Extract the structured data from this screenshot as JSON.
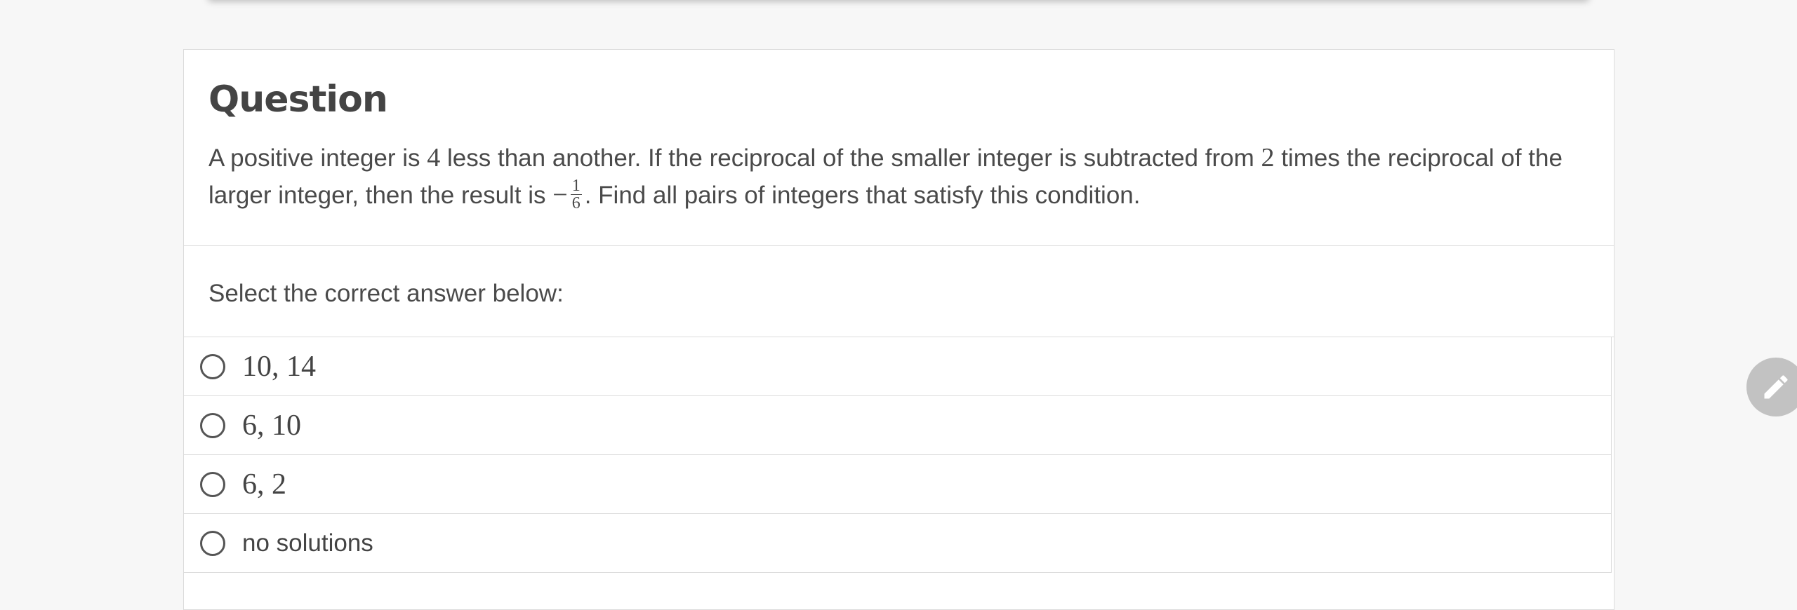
{
  "question": {
    "heading": "Question",
    "text_part1": "A positive integer is ",
    "num_4": "4",
    "text_part2": " less than another. If the reciprocal of the smaller integer is subtracted from ",
    "num_2": "2",
    "text_part3": " times the reciprocal of the larger integer, then the result is ",
    "minus": "−",
    "frac_num": "1",
    "frac_den": "6",
    "text_part4": ". Find all pairs of integers that satisfy this condition."
  },
  "instruction": "Select the correct answer below:",
  "options": [
    {
      "label": "10, 14",
      "kind": "math"
    },
    {
      "label": "6, 10",
      "kind": "math"
    },
    {
      "label": "6, 2",
      "kind": "math"
    },
    {
      "label": "no solutions",
      "kind": "text"
    }
  ],
  "icons": {
    "fab": "pencil-icon"
  },
  "colors": {
    "background": "#f7f7f7",
    "card": "#ffffff",
    "border": "#dcdcdc",
    "text": "#444444",
    "fab": "#c2c2c2"
  }
}
